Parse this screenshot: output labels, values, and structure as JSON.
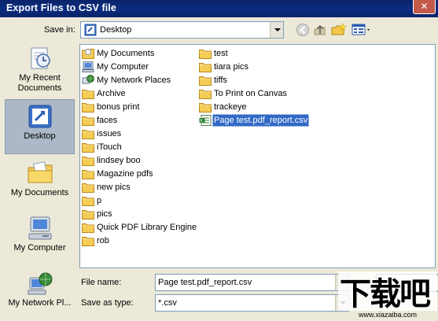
{
  "window": {
    "title": "Export Files to CSV file",
    "close_glyph": "✕"
  },
  "save_in": {
    "label": "Save in:",
    "value": "Desktop"
  },
  "toolbar": {
    "back_icon": "back-arrow-icon",
    "up_icon": "up-folder-icon",
    "new_folder_icon": "new-folder-icon",
    "views_icon": "views-menu-icon"
  },
  "places": [
    {
      "label": "My Recent Documents",
      "icon": "recent-documents-icon"
    },
    {
      "label": "Desktop",
      "icon": "desktop-icon"
    },
    {
      "label": "My Documents",
      "icon": "my-documents-icon"
    },
    {
      "label": "My Computer",
      "icon": "my-computer-icon"
    },
    {
      "label": "My Network Pl...",
      "icon": "network-places-icon"
    }
  ],
  "files_col1": [
    {
      "name": "My Documents",
      "icon": "my-documents-icon"
    },
    {
      "name": "My Computer",
      "icon": "my-computer-icon"
    },
    {
      "name": "My Network Places",
      "icon": "network-places-icon"
    },
    {
      "name": "Archive",
      "icon": "folder-icon"
    },
    {
      "name": "bonus print",
      "icon": "folder-icon"
    },
    {
      "name": "faces",
      "icon": "folder-icon"
    },
    {
      "name": "issues",
      "icon": "folder-icon"
    },
    {
      "name": "iTouch",
      "icon": "folder-icon"
    },
    {
      "name": "lindsey boo",
      "icon": "folder-icon"
    },
    {
      "name": "Magazine pdfs",
      "icon": "folder-icon"
    },
    {
      "name": "new pics",
      "icon": "folder-icon"
    },
    {
      "name": "p",
      "icon": "folder-icon"
    },
    {
      "name": "pics",
      "icon": "folder-icon"
    },
    {
      "name": "Quick PDF Library Engine",
      "icon": "folder-icon"
    },
    {
      "name": "rob",
      "icon": "folder-icon"
    }
  ],
  "files_col2": [
    {
      "name": "test",
      "icon": "folder-icon"
    },
    {
      "name": "tiara pics",
      "icon": "folder-icon"
    },
    {
      "name": "tiffs",
      "icon": "folder-icon"
    },
    {
      "name": "To Print on Canvas",
      "icon": "folder-icon"
    },
    {
      "name": "trackeye",
      "icon": "folder-icon"
    },
    {
      "name": "Page test.pdf_report.csv",
      "icon": "csv-file-icon",
      "selected": true
    }
  ],
  "file_name": {
    "label": "File name:",
    "value": "Page test.pdf_report.csv"
  },
  "save_as_type": {
    "label": "Save as type:",
    "value": "*.csv"
  },
  "watermark": {
    "main": "下载吧",
    "sub": "www.xiazaiba.com"
  }
}
